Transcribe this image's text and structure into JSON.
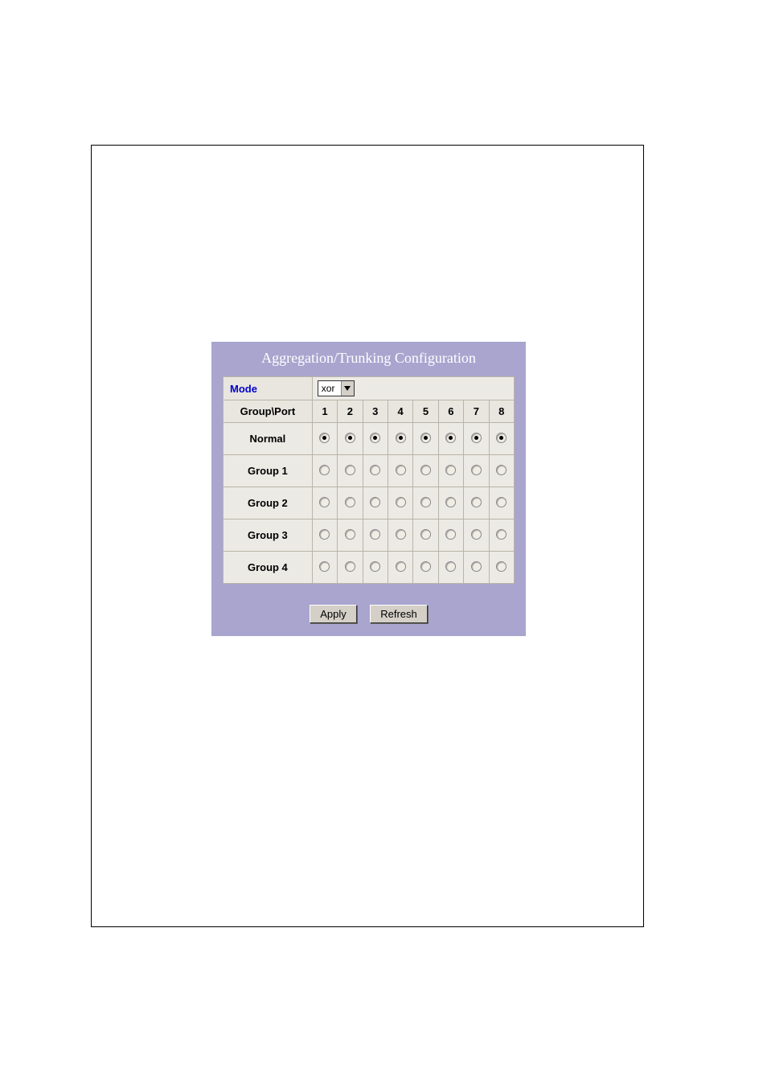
{
  "panel": {
    "title": "Aggregation/Trunking Configuration",
    "mode_label": "Mode",
    "mode_value": "xor",
    "group_port_header": "Group\\Port",
    "ports": [
      "1",
      "2",
      "3",
      "4",
      "5",
      "6",
      "7",
      "8"
    ],
    "rows": [
      {
        "label": "Normal",
        "selected": [
          true,
          true,
          true,
          true,
          true,
          true,
          true,
          true
        ]
      },
      {
        "label": "Group 1",
        "selected": [
          false,
          false,
          false,
          false,
          false,
          false,
          false,
          false
        ]
      },
      {
        "label": "Group 2",
        "selected": [
          false,
          false,
          false,
          false,
          false,
          false,
          false,
          false
        ]
      },
      {
        "label": "Group 3",
        "selected": [
          false,
          false,
          false,
          false,
          false,
          false,
          false,
          false
        ]
      },
      {
        "label": "Group 4",
        "selected": [
          false,
          false,
          false,
          false,
          false,
          false,
          false,
          false
        ]
      }
    ],
    "buttons": {
      "apply": "Apply",
      "refresh": "Refresh"
    }
  }
}
